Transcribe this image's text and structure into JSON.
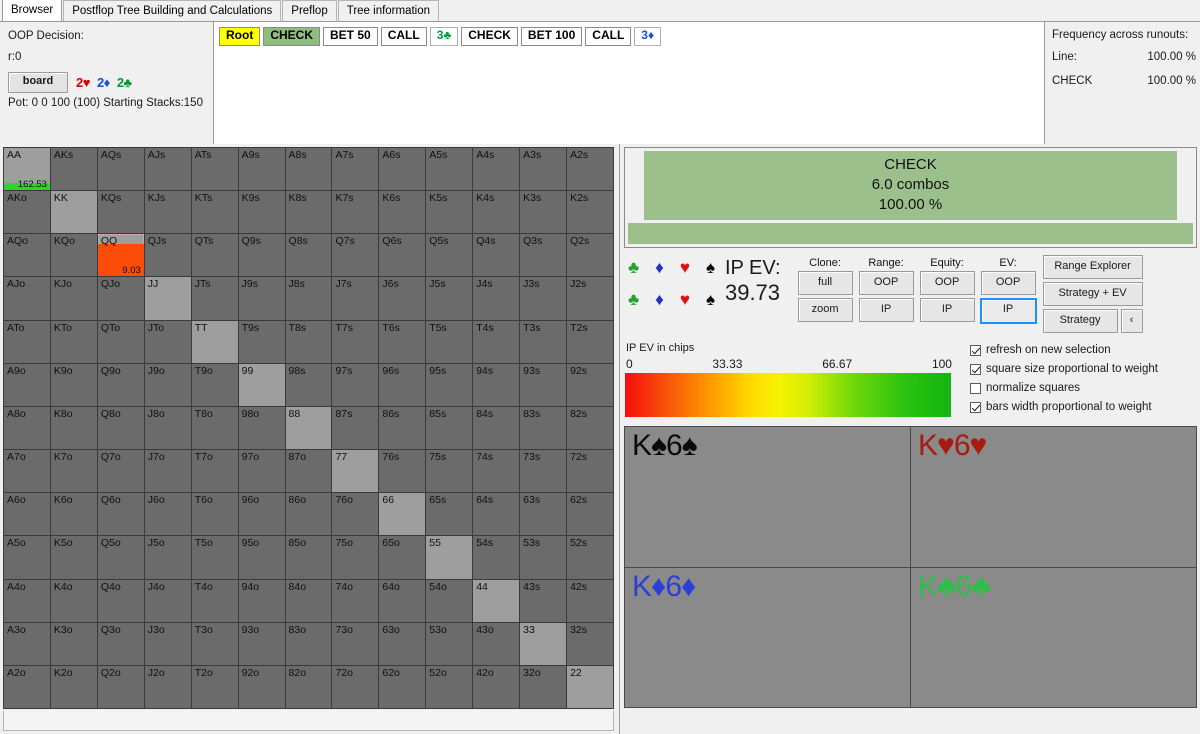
{
  "tabs": [
    {
      "label": "Browser",
      "active": true
    },
    {
      "label": "Postflop Tree Building and Calculations",
      "active": false
    },
    {
      "label": "Preflop",
      "active": false
    },
    {
      "label": "Tree information",
      "active": false
    }
  ],
  "decision": {
    "title": "OOP Decision:",
    "node": "r:0",
    "board_button": "board",
    "board_cards": [
      {
        "text": "2♥",
        "suit": "h"
      },
      {
        "text": "2♦",
        "suit": "d"
      },
      {
        "text": "2♣",
        "suit": "c"
      }
    ],
    "pot_line": "Pot: 0 0 100 (100) Starting Stacks:150"
  },
  "action_line": [
    {
      "label": "Root",
      "kind": "root"
    },
    {
      "label": "CHECK",
      "kind": "check"
    },
    {
      "label": "BET 50",
      "kind": "plain"
    },
    {
      "label": "CALL",
      "kind": "plain"
    },
    {
      "label": "3♣",
      "kind": "card-c"
    },
    {
      "label": "CHECK",
      "kind": "plain"
    },
    {
      "label": "BET 100",
      "kind": "plain"
    },
    {
      "label": "CALL",
      "kind": "plain"
    },
    {
      "label": "3♦",
      "kind": "card-d"
    }
  ],
  "frequency": {
    "title": "Frequency across runouts:",
    "rows": [
      {
        "label": "Line:",
        "value": "100.00 %"
      },
      {
        "label": "CHECK",
        "value": "100.00 %"
      }
    ]
  },
  "action_summary": {
    "name": "CHECK",
    "combos": "6.0 combos",
    "percent": "100.00 %",
    "color": "#9cc08c"
  },
  "suits": {
    "row1": [
      {
        "glyph": "♣",
        "color": "#22a02e",
        "name": "club-icon"
      },
      {
        "glyph": "♦",
        "color": "#2030cc",
        "name": "diamond-icon"
      },
      {
        "glyph": "♥",
        "color": "#e01010",
        "name": "heart-icon"
      },
      {
        "glyph": "♠",
        "color": "#0a0a0a",
        "name": "spade-icon"
      }
    ],
    "row2": [
      {
        "glyph": "♣",
        "color": "#22a02e",
        "name": "club-icon"
      },
      {
        "glyph": "♦",
        "color": "#2030cc",
        "name": "diamond-icon"
      },
      {
        "glyph": "♥",
        "color": "#e01010",
        "name": "heart-icon"
      },
      {
        "glyph": "♠",
        "color": "#0a0a0a",
        "name": "spade-icon"
      }
    ]
  },
  "ev": {
    "label": "IP EV:",
    "value": "39.73",
    "caption": "IP EV in chips"
  },
  "button_columns": [
    {
      "header": "Clone:",
      "top": "full",
      "bottom": "zoom",
      "active": null
    },
    {
      "header": "Range:",
      "top": "OOP",
      "bottom": "IP",
      "active": null
    },
    {
      "header": "Equity:",
      "top": "OOP",
      "bottom": "IP",
      "active": null
    },
    {
      "header": "EV:",
      "top": "OOP",
      "bottom": "IP",
      "active": "bottom"
    }
  ],
  "big_buttons": {
    "range_explorer": "Range Explorer",
    "strategy_ev": "Strategy + EV",
    "strategy": "Strategy",
    "collapse": "‹"
  },
  "scale": {
    "ticks": [
      "0",
      "33.33",
      "66.67",
      "100"
    ],
    "gradient_from": "#f40d0d",
    "gradient_mid": "#f6f200",
    "gradient_to": "#13b412"
  },
  "checkboxes": [
    {
      "label": "refresh on new selection",
      "checked": true
    },
    {
      "label": "square size proportional to weight",
      "checked": true
    },
    {
      "label": "normalize squares",
      "checked": false
    },
    {
      "label": "bars width proportional to weight",
      "checked": true
    }
  ],
  "combos": [
    {
      "rank1": "K",
      "suit1": "♠",
      "rank2": "6",
      "suit2": "♠",
      "cls": "cl-s"
    },
    {
      "rank1": "K",
      "suit1": "♥",
      "rank2": "6",
      "suit2": "♥",
      "cls": "cl-h"
    },
    {
      "rank1": "K",
      "suit1": "♦",
      "rank2": "6",
      "suit2": "♦",
      "cls": "cl-d"
    },
    {
      "rank1": "K",
      "suit1": "♣",
      "rank2": "6",
      "suit2": "♣",
      "cls": "cl-c"
    }
  ],
  "matrix": {
    "ranks": [
      "A",
      "K",
      "Q",
      "J",
      "T",
      "9",
      "8",
      "7",
      "6",
      "5",
      "4",
      "3",
      "2"
    ],
    "cell_color": "#6b6b6b",
    "pair_color": "#9e9e9e",
    "highlights": [
      {
        "hand": "AA",
        "value": "162.53",
        "fill": "#2bd62b",
        "fill_height_pct": 16,
        "selected": false
      },
      {
        "hand": "QQ",
        "value": "9.03",
        "fill": "#fc4c0a",
        "fill_height_pct": 78,
        "selected": true
      }
    ]
  }
}
